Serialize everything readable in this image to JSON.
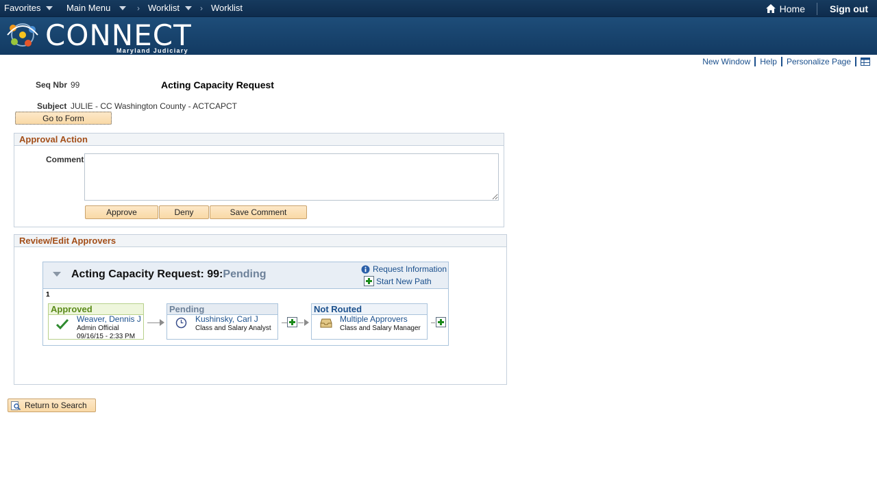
{
  "nav": {
    "favorites": "Favorites",
    "main_menu": "Main Menu",
    "crumb1": "Worklist",
    "crumb2": "Worklist",
    "home": "Home",
    "sign_out": "Sign out"
  },
  "brand": {
    "name": "CONNECT",
    "sub": "Maryland Judiciary"
  },
  "page_links": {
    "new_window": "New Window",
    "help": "Help",
    "personalize": "Personalize Page"
  },
  "header": {
    "seq_label": "Seq Nbr",
    "seq_value": "99",
    "title": "Acting Capacity Request",
    "subject_label": "Subject",
    "subject_value": "JULIE - CC Washington County - ACTCAPCT",
    "go_to_form": "Go to Form"
  },
  "approval_action": {
    "heading": "Approval Action",
    "comment_label": "Comment",
    "comment_value": "",
    "approve": "Approve",
    "deny": "Deny",
    "save_comment": "Save Comment"
  },
  "review": {
    "heading": "Review/Edit Approvers",
    "map_title": "Acting Capacity Request: 99:",
    "map_status": "Pending",
    "request_info": "Request Information",
    "start_new_path": "Start New Path",
    "path_number": "1",
    "steps": [
      {
        "status": "Approved",
        "name": "Weaver, Dennis J",
        "role": "Admin Official",
        "date": "09/16/15 - 2:33 PM",
        "color": "#5a8a1a"
      },
      {
        "status": "Pending",
        "name": "Kushinsky, Carl J",
        "role": "Class and Salary Analyst",
        "color": "#6d8199"
      },
      {
        "status": "Not Routed",
        "name": "Multiple Approvers",
        "role": "Class and Salary Manager",
        "color": "#1a4f8c"
      }
    ]
  },
  "footer": {
    "return_to_search": "Return to Search"
  }
}
